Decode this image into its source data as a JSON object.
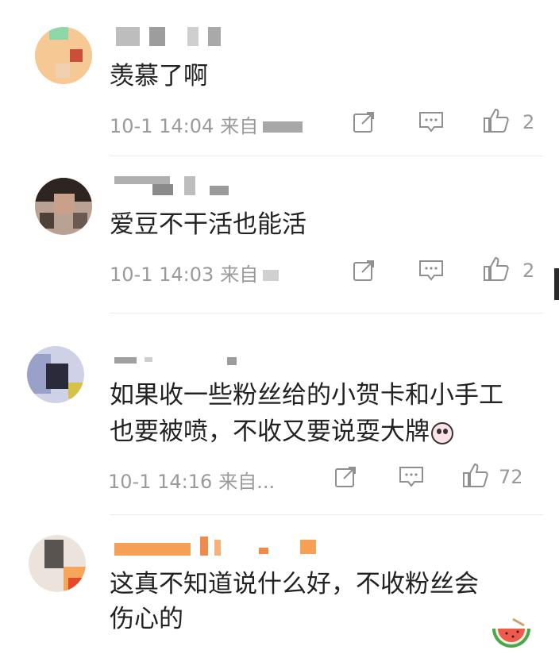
{
  "comments": [
    {
      "text": "羡慕了啊",
      "time": "10-1 14:04",
      "source": "来自",
      "likes": "2",
      "avatar_colors": [
        "#f2b67e",
        "#8fd6a9",
        "#f7c28c",
        "#c94f3a",
        "#7cc9a0",
        "#f0d0b0"
      ]
    },
    {
      "text": "爱豆不干活也能活",
      "time": "10-1 14:03",
      "source": "来自",
      "likes": "2",
      "avatar_colors": [
        "#3a2a24",
        "#8b6c5c",
        "#c9a08a",
        "#50403a",
        "#a58874",
        "#6c5a52"
      ]
    },
    {
      "text_line1": "如果收一些粉丝给的小贺卡和小手工",
      "text_line2": "也要被喷，不收又要说耍大牌",
      "time": "10-1 14:16",
      "source": "来自...",
      "likes": "72",
      "avatar_colors": [
        "#9aa1c9",
        "#3c3c50",
        "#cfd2e6",
        "#d6c24a",
        "#2a2a3a",
        "#b6b6cc"
      ]
    },
    {
      "text_line1": "这真不知道说什么好，不收粉丝会",
      "text_line2": "伤心的",
      "avatar_colors": [
        "#d9d2cc",
        "#5a5450",
        "#e24a2a",
        "#f5a65a",
        "#ece4dc",
        "#3a3430"
      ]
    }
  ],
  "icons": {
    "share": "share-icon",
    "comment": "comment-icon",
    "like": "thumbs-up-icon",
    "watermelon": "watermelon-icon"
  }
}
